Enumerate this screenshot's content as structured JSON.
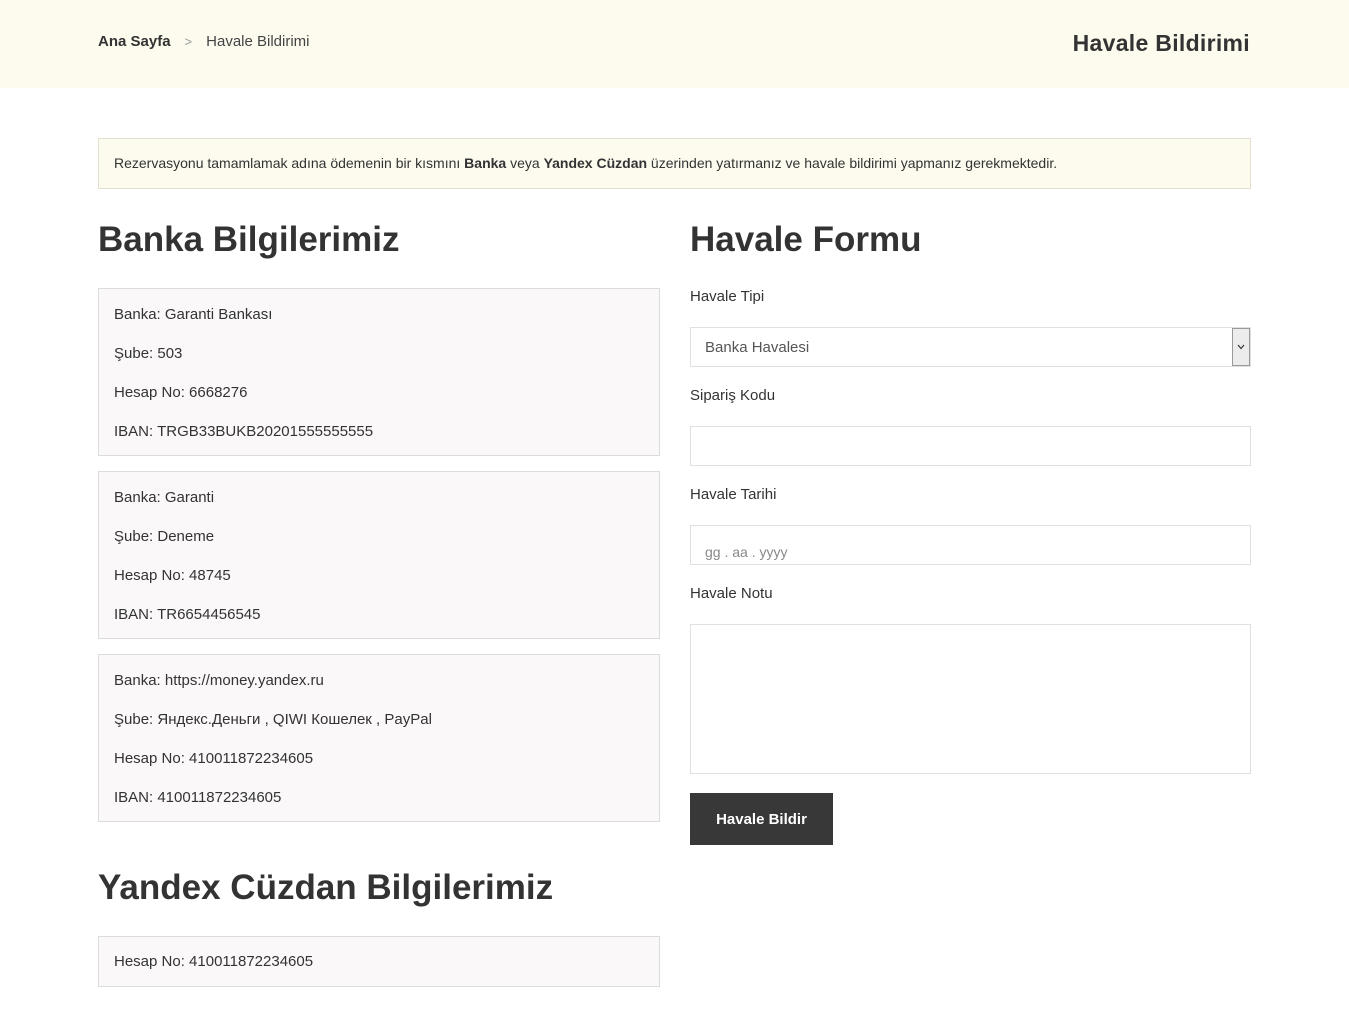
{
  "breadcrumb": {
    "home": "Ana Sayfa",
    "separator": ">",
    "current": "Havale Bildirimi"
  },
  "page_title": "Havale Bildirimi",
  "notice": {
    "text_1": "Rezervasyonu tamamlamak adına ödemenin bir kısmını ",
    "bold_1": "Banka",
    "text_2": " veya ",
    "bold_2": "Yandex Cüzdan",
    "text_3": " üzerinden yatırmanız ve havale bildirimi yapmanız gerekmektedir."
  },
  "bank_section": {
    "title": "Banka Bilgilerimiz",
    "accounts": [
      {
        "bank": "Banka: Garanti Bankası",
        "branch": "Şube: 503",
        "account_no": "Hesap No: 6668276",
        "iban": "IBAN: TRGB33BUKB20201555555555"
      },
      {
        "bank": "Banka: Garanti",
        "branch": "Şube: Deneme",
        "account_no": "Hesap No: 48745",
        "iban": "IBAN: TR6654456545"
      },
      {
        "bank": "Banka: https://money.yandex.ru",
        "branch": "Şube: Яндекс.Деньги , QIWI Кошелек , PayPal",
        "account_no": "Hesap No: 410011872234605",
        "iban": "IBAN: 410011872234605"
      }
    ]
  },
  "yandex_section": {
    "title": "Yandex Cüzdan Bilgilerimiz",
    "account_no": "Hesap No: 410011872234605"
  },
  "form": {
    "title": "Havale Formu",
    "transfer_type_label": "Havale Tipi",
    "transfer_type_value": "Banka Havalesi",
    "order_code_label": "Sipariş Kodu",
    "order_code_value": "",
    "date_label": "Havale Tarihi",
    "date_placeholder": "gg . aa . yyyy",
    "note_label": "Havale Notu",
    "note_value": "",
    "submit_label": "Havale Bildir"
  },
  "icons": {
    "breadcrumb_separator": "chevron-right-icon",
    "select_arrow": "chevron-down-icon"
  },
  "colors": {
    "topbar_bg": "#fdfbee",
    "notice_bg": "#fdfbee",
    "box_bg": "#faf8f8",
    "button_bg": "#383838"
  }
}
